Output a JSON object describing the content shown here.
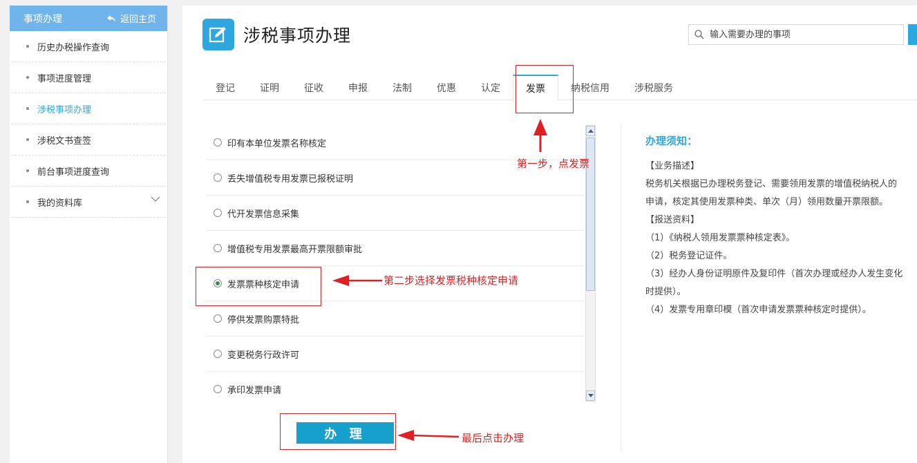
{
  "sidebar": {
    "title": "事项办理",
    "back_label": "返回主页",
    "items": [
      {
        "label": "历史办税操作查询"
      },
      {
        "label": "事项进度管理"
      },
      {
        "label": "涉税事项办理"
      },
      {
        "label": "涉税文书查签"
      },
      {
        "label": "前台事项进度查询"
      },
      {
        "label": "我的资料库"
      }
    ]
  },
  "header": {
    "title": "涉税事项办理",
    "search_placeholder": "输入需要办理的事项"
  },
  "tabs": [
    "登记",
    "证明",
    "征收",
    "申报",
    "法制",
    "优惠",
    "认定",
    "发票",
    "纳税信用",
    "涉税服务"
  ],
  "active_tab": "发票",
  "options": [
    {
      "label": "印有本单位发票名称核定",
      "selected": false
    },
    {
      "label": "丢失增值税专用发票已报税证明",
      "selected": false
    },
    {
      "label": "代开发票信息采集",
      "selected": false
    },
    {
      "label": "增值税专用发票最高开票限额审批",
      "selected": false
    },
    {
      "label": "发票票种核定申请",
      "selected": true
    },
    {
      "label": "停供发票购票特批",
      "selected": false
    },
    {
      "label": "变更税务行政许可",
      "selected": false
    },
    {
      "label": "承印发票申请",
      "selected": false
    }
  ],
  "submit_label": "办 理",
  "notice": {
    "title": "办理须知：",
    "lines": [
      "【业务描述】",
      "税务机关根据已办理税务登记、需要领用发票的增值税纳税人的",
      "申请，核定其使用发票种类、单次（月）领用数量开票限额。",
      "【报送资料】",
      "（1）《纳税人领用发票票种核定表》。",
      "（2）税务登记证件。",
      "（3）经办人身份证明原件及复印件（首次办理或经办人发生变化",
      "时提供）。",
      "（4）发票专用章印模（首次申请发票票种核定时提供）。"
    ]
  },
  "annotations": {
    "step1": "第一步，点发票",
    "step2": "第二步选择发票税种核定申请",
    "step3": "最后点击办理"
  },
  "colors": {
    "accent": "#2ea7e0",
    "sidebar_header": "#6fb4ea",
    "annotation": "#e02020",
    "button": "#17a0cc"
  }
}
